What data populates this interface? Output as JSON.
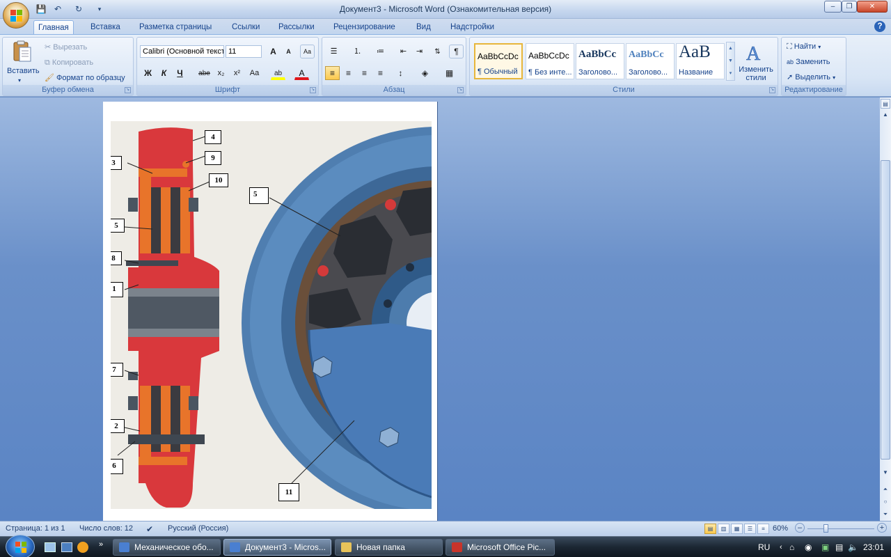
{
  "window": {
    "title": "Документ3 - Microsoft Word (Ознакомительная версия)",
    "controls": {
      "minimize": "–",
      "maximize": "❐",
      "close": "✕"
    }
  },
  "quick_access": {
    "save": "💾",
    "undo": "↶",
    "redo": "↻",
    "customize": "▾"
  },
  "tabs": [
    "Главная",
    "Вставка",
    "Разметка страницы",
    "Ссылки",
    "Рассылки",
    "Рецензирование",
    "Вид",
    "Надстройки"
  ],
  "help_icon": "?",
  "clipboard": {
    "group_label": "Буфер обмена",
    "paste": "Вставить",
    "cut": "Вырезать",
    "copy": "Копировать",
    "format_painter": "Формат по образцу"
  },
  "font": {
    "group_label": "Шрифт",
    "font_name": "Calibri (Основной текст)",
    "font_size": "11",
    "grow": "A",
    "shrink": "A",
    "clear": "Aa",
    "bold": "Ж",
    "italic": "К",
    "underline": "Ч",
    "strike": "abe",
    "subscript": "x₂",
    "superscript": "x²",
    "case": "Aa",
    "highlight": "ab",
    "color": "A"
  },
  "paragraph": {
    "group_label": "Абзац",
    "pilcrow": "¶"
  },
  "styles": {
    "group_label": "Стили",
    "items": [
      {
        "sample": "AaBbCcDc",
        "name": "¶ Обычный"
      },
      {
        "sample": "AaBbCcDc",
        "name": "¶ Без инте..."
      },
      {
        "sample": "AaBbCc",
        "name": "Заголово..."
      },
      {
        "sample": "AaBbCc",
        "name": "Заголово..."
      },
      {
        "sample": "AaB",
        "name": "Название"
      }
    ],
    "change_styles": "Изменить стили"
  },
  "editing": {
    "group_label": "Редактирование",
    "find": "Найти",
    "replace": "Заменить",
    "select": "Выделить"
  },
  "figure": {
    "callouts": [
      "4",
      "9",
      "3",
      "10",
      "5",
      "5",
      "8",
      "1",
      "7",
      "2",
      "6",
      "11"
    ]
  },
  "status": {
    "page": "Страница: 1 из 1",
    "words": "Число слов: 12",
    "language": "Русский (Россия)",
    "zoom": "60%"
  },
  "taskbar": {
    "items": [
      "Механическое обо...",
      "Документ3 - Micros...",
      "Новая папка",
      "Microsoft Office Pic..."
    ],
    "lang": "RU",
    "clock": "23:01"
  },
  "colors": {
    "ribbon_bg": "#d8e5f5",
    "doc_bg": "#6a90c9",
    "taskbar": "#1c2733",
    "accent": "#15428b"
  }
}
